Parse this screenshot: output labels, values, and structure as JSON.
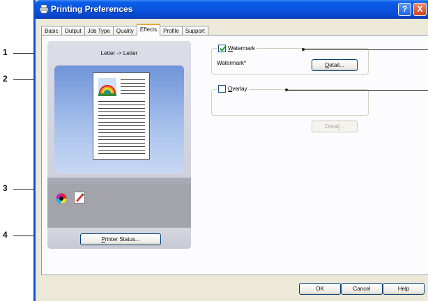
{
  "window": {
    "title": "Printing Preferences",
    "help_glyph": "?",
    "close_glyph": "X"
  },
  "tabs": [
    {
      "label": "Basic"
    },
    {
      "label": "Output"
    },
    {
      "label": "Job Type"
    },
    {
      "label": "Quality"
    },
    {
      "label": "Effects",
      "active": true
    },
    {
      "label": "Profile"
    },
    {
      "label": "Support"
    }
  ],
  "preview": {
    "paper_label": "Letter -> Letter",
    "icons": [
      "color-icon",
      "edit-icon"
    ],
    "printer_status_prefix": "",
    "printer_status_u": "P",
    "printer_status_rest": "rinter Status..."
  },
  "watermark": {
    "checked": true,
    "label_u": "W",
    "label_rest": "atermark",
    "value": "Watermark*",
    "detail_u": "D",
    "detail_rest": "etail..."
  },
  "overlay": {
    "checked": false,
    "label_u": "O",
    "label_rest": "verlay",
    "detail_prefix": "Detai",
    "detail_u": "l",
    "detail_rest": "..."
  },
  "footer": {
    "ok": "OK",
    "cancel": "Cancel",
    "help": "Help"
  },
  "callouts": {
    "c1": "1",
    "c2": "2",
    "c3": "3",
    "c4": "4"
  }
}
